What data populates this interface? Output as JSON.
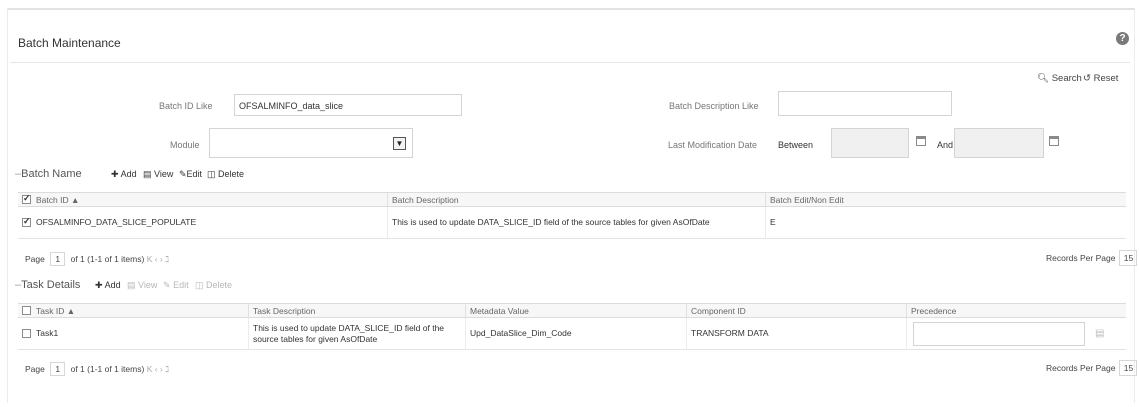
{
  "page": {
    "title": "Batch Maintenance",
    "help_icon": "?"
  },
  "search_bar": {
    "search_label": "Search",
    "reset_label": "Reset"
  },
  "filters": {
    "batch_id_label": "Batch ID Like",
    "batch_id_value": "OFSALMINFO_data_slice",
    "batch_desc_label": "Batch Description Like",
    "batch_desc_value": "",
    "module_label": "Module",
    "module_value": "",
    "last_mod_label": "Last Modification Date",
    "between_label": "Between",
    "and_label": "And",
    "from_date": "",
    "to_date": ""
  },
  "batch_section": {
    "title": "Batch Name",
    "actions": {
      "add": "Add",
      "view": "View",
      "edit": "Edit",
      "delete": "Delete"
    },
    "columns": [
      "Batch ID",
      "Batch Description",
      "Batch Edit/Non Edit"
    ],
    "sort_indicator": "▲",
    "rows": [
      {
        "batch_id": "OFSALMINFO_DATA_SLICE_POPULATE",
        "description": "This is used to update DATA_SLICE_ID field of the source tables for given AsOfDate",
        "edit_flag": "E",
        "checked": true
      }
    ],
    "pager": {
      "page_label": "Page",
      "page_num": "1",
      "summary": "of 1 (1-1 of 1 items)",
      "nav": "K  ‹  ›  ℷ"
    },
    "records_per_page_label": "Records Per Page",
    "records_per_page": "15"
  },
  "task_section": {
    "title": "Task Details",
    "actions": {
      "add": "Add",
      "view": "View",
      "edit": "Edit",
      "delete": "Delete"
    },
    "columns": [
      "Task ID",
      "Task Description",
      "Metadata Value",
      "Component ID",
      "Precedence"
    ],
    "sort_indicator": "▲",
    "rows": [
      {
        "task_id": "Task1",
        "description": "This is used to update DATA_SLICE_ID field of the source tables for given AsOfDate",
        "metadata": "Upd_DataSlice_Dim_Code",
        "component": "TRANSFORM DATA",
        "precedence": "",
        "checked": false
      }
    ],
    "pager": {
      "page_label": "Page",
      "page_num": "1",
      "summary": "of 1 (1-1 of 1 items)",
      "nav": "K  ‹  ›  ℷ"
    },
    "records_per_page_label": "Records Per Page",
    "records_per_page": "15"
  }
}
